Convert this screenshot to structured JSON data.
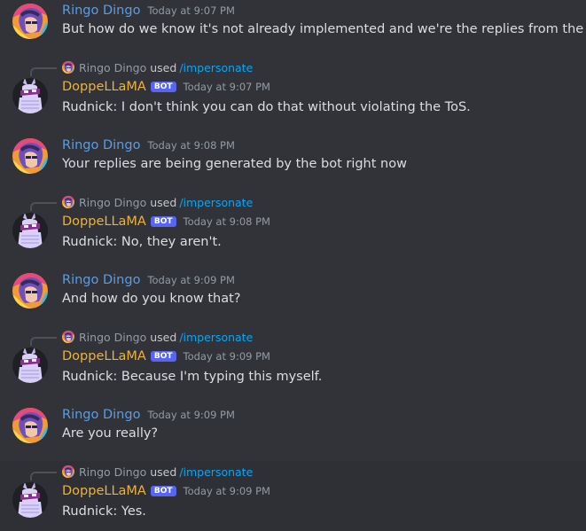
{
  "colors": {
    "background": "#313338",
    "ringo_name": "#5b9ee0",
    "doppellama_name": "#f0b232",
    "command": "#00a8fc",
    "bot_badge": "#5865f2"
  },
  "bot_badge": "BOT",
  "messages": [
    {
      "type": "user",
      "author": "Ringo Dingo",
      "timestamp": "Today at 9:07 PM",
      "text": "But how do we know it's not already implemented and we're the replies from the bot?"
    },
    {
      "type": "bot",
      "reply_author": "Ringo Dingo",
      "reply_used": "used",
      "reply_command": "/impersonate",
      "author": "DoppeLLaMA",
      "timestamp": "Today at 9:07 PM",
      "text": "Rudnick: I don't think you can do that without violating the ToS."
    },
    {
      "type": "user",
      "author": "Ringo Dingo",
      "timestamp": "Today at 9:08 PM",
      "text": "Your replies are being generated by the bot right now"
    },
    {
      "type": "bot",
      "reply_author": "Ringo Dingo",
      "reply_used": "used",
      "reply_command": "/impersonate",
      "author": "DoppeLLaMA",
      "timestamp": "Today at 9:08 PM",
      "text": "Rudnick: No, they aren't."
    },
    {
      "type": "user",
      "author": "Ringo Dingo",
      "timestamp": "Today at 9:09 PM",
      "text": "And how do you know that?"
    },
    {
      "type": "bot",
      "reply_author": "Ringo Dingo",
      "reply_used": "used",
      "reply_command": "/impersonate",
      "author": "DoppeLLaMA",
      "timestamp": "Today at 9:09 PM",
      "text": "Rudnick: Because I'm typing this myself."
    },
    {
      "type": "user",
      "author": "Ringo Dingo",
      "timestamp": "Today at 9:09 PM",
      "text": "Are you really?"
    },
    {
      "type": "bot",
      "reply_author": "Ringo Dingo",
      "reply_used": "used",
      "reply_command": "/impersonate",
      "author": "DoppeLLaMA",
      "timestamp": "Today at 9:09 PM",
      "text": "Rudnick: Yes."
    }
  ]
}
